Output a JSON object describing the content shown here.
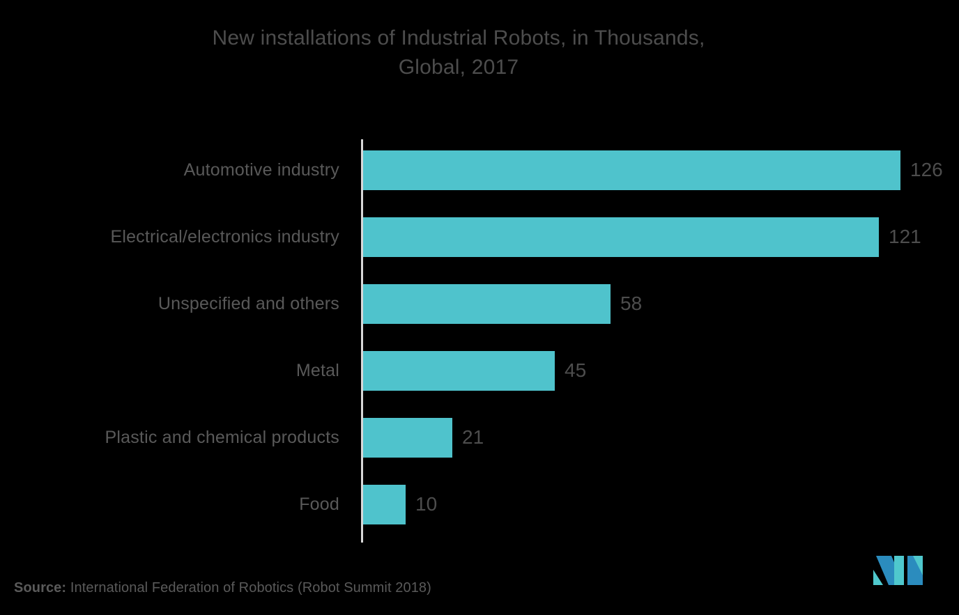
{
  "chart_data": {
    "type": "bar",
    "orientation": "horizontal",
    "title": "New installations of Industrial Robots, in Thousands,\nGlobal, 2017",
    "title_line1": "New installations of Industrial Robots, in Thousands,",
    "title_line2": "Global, 2017",
    "xlabel": "",
    "ylabel": "",
    "categories": [
      "Automotive industry",
      "Electrical/electronics industry",
      "Unspecified and others",
      "Metal",
      "Plastic and chemical products",
      "Food"
    ],
    "values": [
      126,
      121,
      58,
      45,
      21,
      10
    ],
    "value_labels": [
      "126",
      "121",
      "58",
      "45",
      "21",
      "10"
    ],
    "xlim": [
      0,
      126
    ],
    "grid": false,
    "legend": null,
    "units": "thousands",
    "bar_color": "#4fc3cc",
    "background_color": "#000000",
    "text_color": "#4d4d4d",
    "axis_color": "#d8d8d8"
  },
  "footer": {
    "source_key": "Source:",
    "source_value": " International Federation of Robotics (Robot Summit 2018)"
  },
  "logo": {
    "name": "mordor-intelligence-logo",
    "teal": "#4fc8cd",
    "blue": "#2b8cbe"
  }
}
